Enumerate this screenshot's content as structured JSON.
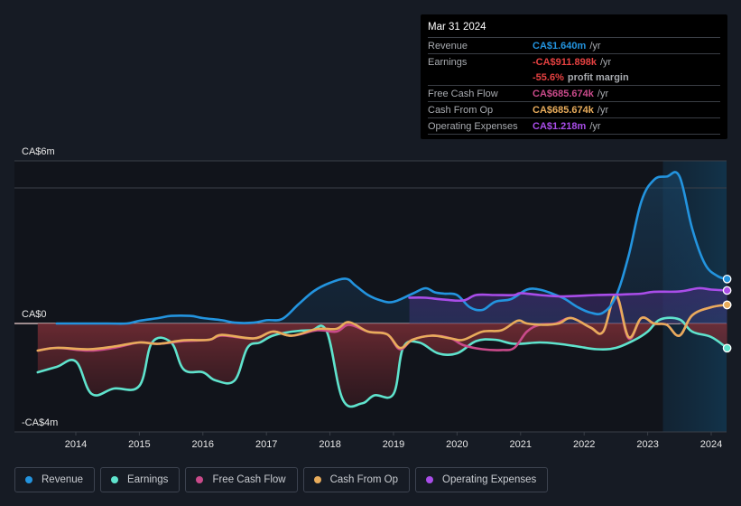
{
  "tooltip": {
    "date": "Mar 31 2024",
    "rows": [
      {
        "label": "Revenue",
        "value": "CA$1.640m",
        "unit": "/yr",
        "color": "#2394df"
      },
      {
        "label": "Earnings",
        "value": "-CA$911.898k",
        "unit": "/yr",
        "color": "#e64141"
      },
      {
        "label": "",
        "value": "-55.6%",
        "unit": "profit margin",
        "color": "#e64141"
      },
      {
        "label": "Free Cash Flow",
        "value": "CA$685.674k",
        "unit": "/yr",
        "color": "#c94a8a"
      },
      {
        "label": "Cash From Op",
        "value": "CA$685.674k",
        "unit": "/yr",
        "color": "#e8ac5b"
      },
      {
        "label": "Operating Expenses",
        "value": "CA$1.218m",
        "unit": "/yr",
        "color": "#a94de9"
      }
    ]
  },
  "legend": [
    {
      "label": "Revenue",
      "color": "#2394df"
    },
    {
      "label": "Earnings",
      "color": "#5fe3cd"
    },
    {
      "label": "Free Cash Flow",
      "color": "#c94a8a"
    },
    {
      "label": "Cash From Op",
      "color": "#e8ac5b"
    },
    {
      "label": "Operating Expenses",
      "color": "#a94de9"
    }
  ],
  "chart_data": {
    "type": "line",
    "title": "",
    "xlabel": "",
    "ylabel": "",
    "currency": "CAD",
    "y_unit": "CA$m",
    "ylim": [
      -4,
      6
    ],
    "xlim": [
      2013.4,
      2024.25
    ],
    "y_tick_labels": [
      {
        "value": 6,
        "label": "CA$6m"
      },
      {
        "value": 0,
        "label": "CA$0"
      },
      {
        "value": -4,
        "label": "-CA$4m"
      }
    ],
    "gridlines": [
      6,
      5,
      0
    ],
    "x_ticks": [
      2014,
      2015,
      2016,
      2017,
      2018,
      2019,
      2020,
      2021,
      2022,
      2023,
      2024
    ],
    "x_tick_labels": [
      "2014",
      "2015",
      "2016",
      "2017",
      "2018",
      "2019",
      "2020",
      "2021",
      "2022",
      "2023",
      "2024"
    ],
    "highlight_range": [
      2023.24,
      2024.25
    ],
    "legend_position": "bottom",
    "series": [
      {
        "name": "Revenue",
        "color": "#2394df",
        "points": [
          [
            2013.7,
            0.0
          ],
          [
            2014.0,
            0.0
          ],
          [
            2014.5,
            0.0
          ],
          [
            2014.8,
            0.0
          ],
          [
            2015.0,
            0.1
          ],
          [
            2015.3,
            0.2
          ],
          [
            2015.5,
            0.28
          ],
          [
            2015.8,
            0.28
          ],
          [
            2016.0,
            0.2
          ],
          [
            2016.3,
            0.12
          ],
          [
            2016.5,
            0.03
          ],
          [
            2016.8,
            0.03
          ],
          [
            2017.0,
            0.12
          ],
          [
            2017.25,
            0.17
          ],
          [
            2017.5,
            0.7
          ],
          [
            2017.75,
            1.2
          ],
          [
            2018.0,
            1.5
          ],
          [
            2018.25,
            1.65
          ],
          [
            2018.4,
            1.4
          ],
          [
            2018.6,
            1.05
          ],
          [
            2018.8,
            0.85
          ],
          [
            2019.0,
            0.8
          ],
          [
            2019.3,
            1.1
          ],
          [
            2019.5,
            1.3
          ],
          [
            2019.65,
            1.15
          ],
          [
            2019.8,
            1.1
          ],
          [
            2020.0,
            1.05
          ],
          [
            2020.2,
            0.6
          ],
          [
            2020.4,
            0.5
          ],
          [
            2020.6,
            0.8
          ],
          [
            2020.85,
            0.9
          ],
          [
            2021.1,
            1.25
          ],
          [
            2021.3,
            1.25
          ],
          [
            2021.5,
            1.1
          ],
          [
            2021.7,
            0.9
          ],
          [
            2021.9,
            0.6
          ],
          [
            2022.1,
            0.4
          ],
          [
            2022.3,
            0.4
          ],
          [
            2022.5,
            1.0
          ],
          [
            2022.7,
            2.5
          ],
          [
            2022.9,
            4.5
          ],
          [
            2023.1,
            5.3
          ],
          [
            2023.3,
            5.42
          ],
          [
            2023.5,
            5.43
          ],
          [
            2023.7,
            3.5
          ],
          [
            2023.9,
            2.2
          ],
          [
            2024.1,
            1.75
          ],
          [
            2024.25,
            1.64
          ]
        ]
      },
      {
        "name": "Earnings",
        "color": "#5fe3cd",
        "points": [
          [
            2013.4,
            -1.8
          ],
          [
            2013.7,
            -1.6
          ],
          [
            2014.0,
            -1.4
          ],
          [
            2014.25,
            -2.6
          ],
          [
            2014.6,
            -2.4
          ],
          [
            2015.0,
            -2.3
          ],
          [
            2015.2,
            -0.7
          ],
          [
            2015.5,
            -0.7
          ],
          [
            2015.7,
            -1.7
          ],
          [
            2016.0,
            -1.8
          ],
          [
            2016.2,
            -2.1
          ],
          [
            2016.5,
            -2.1
          ],
          [
            2016.7,
            -0.9
          ],
          [
            2016.9,
            -0.7
          ],
          [
            2017.1,
            -0.45
          ],
          [
            2017.4,
            -0.3
          ],
          [
            2017.7,
            -0.25
          ],
          [
            2017.95,
            -0.3
          ],
          [
            2018.2,
            -2.8
          ],
          [
            2018.5,
            -2.95
          ],
          [
            2018.7,
            -2.65
          ],
          [
            2019.0,
            -2.6
          ],
          [
            2019.15,
            -0.9
          ],
          [
            2019.4,
            -0.7
          ],
          [
            2019.7,
            -1.1
          ],
          [
            2020.0,
            -1.1
          ],
          [
            2020.3,
            -0.65
          ],
          [
            2020.6,
            -0.6
          ],
          [
            2020.9,
            -0.75
          ],
          [
            2021.3,
            -0.7
          ],
          [
            2021.6,
            -0.75
          ],
          [
            2021.9,
            -0.85
          ],
          [
            2022.2,
            -0.95
          ],
          [
            2022.5,
            -0.9
          ],
          [
            2022.8,
            -0.6
          ],
          [
            2023.0,
            -0.3
          ],
          [
            2023.2,
            0.15
          ],
          [
            2023.5,
            0.15
          ],
          [
            2023.7,
            -0.3
          ],
          [
            2024.0,
            -0.5
          ],
          [
            2024.25,
            -0.91
          ]
        ]
      },
      {
        "name": "Free Cash Flow",
        "color": "#c94a8a",
        "points": [
          [
            2013.4,
            -1.0
          ],
          [
            2013.7,
            -0.9
          ],
          [
            2014.2,
            -1.0
          ],
          [
            2014.6,
            -0.9
          ],
          [
            2015.0,
            -0.7
          ],
          [
            2015.3,
            -0.75
          ],
          [
            2015.7,
            -0.65
          ],
          [
            2016.1,
            -0.6
          ],
          [
            2016.3,
            -0.45
          ],
          [
            2016.8,
            -0.55
          ],
          [
            2017.1,
            -0.3
          ],
          [
            2017.4,
            -0.45
          ],
          [
            2017.8,
            -0.25
          ],
          [
            2018.1,
            -0.3
          ],
          [
            2018.3,
            -0.05
          ],
          [
            2018.6,
            -0.3
          ],
          [
            2018.9,
            -0.4
          ],
          [
            2019.1,
            -0.95
          ],
          [
            2019.3,
            -0.6
          ],
          [
            2019.6,
            -0.45
          ],
          [
            2019.9,
            -0.55
          ],
          [
            2020.1,
            -0.8
          ],
          [
            2020.4,
            -0.95
          ],
          [
            2020.7,
            -0.98
          ],
          [
            2020.9,
            -0.9
          ],
          [
            2021.1,
            -0.3
          ],
          [
            2021.3,
            -0.05
          ],
          [
            2021.55,
            0.0
          ],
          [
            2021.8,
            0.2
          ],
          [
            2022.1,
            -0.15
          ],
          [
            2022.3,
            -0.3
          ],
          [
            2022.5,
            1.0
          ],
          [
            2022.7,
            -0.55
          ],
          [
            2022.9,
            0.2
          ],
          [
            2023.1,
            0.0
          ],
          [
            2023.3,
            -0.05
          ],
          [
            2023.5,
            -0.45
          ],
          [
            2023.7,
            0.3
          ],
          [
            2024.0,
            0.6
          ],
          [
            2024.25,
            0.686
          ]
        ]
      },
      {
        "name": "Cash From Op",
        "color": "#e8ac5b",
        "points": [
          [
            2013.4,
            -1.0
          ],
          [
            2013.7,
            -0.9
          ],
          [
            2014.2,
            -0.95
          ],
          [
            2014.6,
            -0.85
          ],
          [
            2015.0,
            -0.7
          ],
          [
            2015.3,
            -0.75
          ],
          [
            2015.7,
            -0.62
          ],
          [
            2016.1,
            -0.6
          ],
          [
            2016.3,
            -0.42
          ],
          [
            2016.8,
            -0.55
          ],
          [
            2017.1,
            -0.3
          ],
          [
            2017.4,
            -0.45
          ],
          [
            2017.8,
            -0.2
          ],
          [
            2018.1,
            -0.2
          ],
          [
            2018.3,
            0.05
          ],
          [
            2018.6,
            -0.3
          ],
          [
            2018.9,
            -0.4
          ],
          [
            2019.1,
            -0.9
          ],
          [
            2019.3,
            -0.6
          ],
          [
            2019.6,
            -0.45
          ],
          [
            2019.9,
            -0.55
          ],
          [
            2020.1,
            -0.6
          ],
          [
            2020.4,
            -0.3
          ],
          [
            2020.7,
            -0.25
          ],
          [
            2020.95,
            0.1
          ],
          [
            2021.1,
            0.0
          ],
          [
            2021.35,
            -0.05
          ],
          [
            2021.6,
            0.0
          ],
          [
            2021.8,
            0.2
          ],
          [
            2022.1,
            -0.15
          ],
          [
            2022.3,
            -0.3
          ],
          [
            2022.5,
            1.05
          ],
          [
            2022.7,
            -0.5
          ],
          [
            2022.9,
            0.2
          ],
          [
            2023.1,
            0.0
          ],
          [
            2023.3,
            -0.05
          ],
          [
            2023.5,
            -0.45
          ],
          [
            2023.7,
            0.3
          ],
          [
            2024.0,
            0.6
          ],
          [
            2024.25,
            0.686
          ]
        ]
      },
      {
        "name": "Operating Expenses",
        "color": "#a94de9",
        "points": [
          [
            2019.25,
            0.95
          ],
          [
            2019.5,
            0.95
          ],
          [
            2019.8,
            0.88
          ],
          [
            2020.1,
            0.85
          ],
          [
            2020.3,
            1.05
          ],
          [
            2020.6,
            1.05
          ],
          [
            2020.9,
            1.05
          ],
          [
            2021.0,
            1.12
          ],
          [
            2021.3,
            1.05
          ],
          [
            2021.6,
            1.0
          ],
          [
            2021.9,
            1.02
          ],
          [
            2022.2,
            1.05
          ],
          [
            2022.6,
            1.07
          ],
          [
            2022.9,
            1.1
          ],
          [
            2023.1,
            1.17
          ],
          [
            2023.5,
            1.18
          ],
          [
            2023.8,
            1.3
          ],
          [
            2024.0,
            1.25
          ],
          [
            2024.25,
            1.218
          ]
        ]
      }
    ]
  }
}
